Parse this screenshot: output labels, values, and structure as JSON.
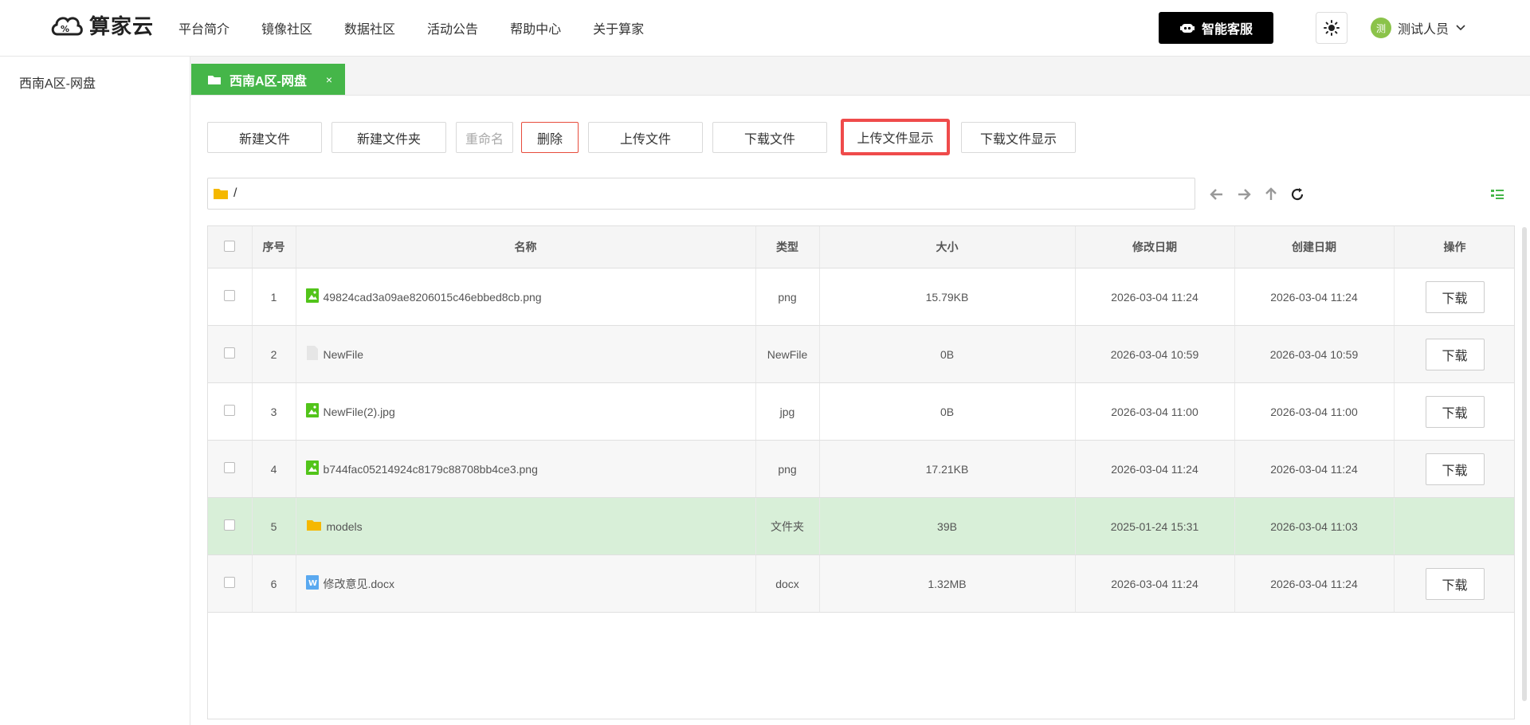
{
  "header": {
    "logo_text": "算家云",
    "nav": [
      "平台简介",
      "镜像社区",
      "数据社区",
      "活动公告",
      "帮助中心",
      "关于算家"
    ],
    "service_label": "智能客服",
    "user_avatar": "测",
    "user_name": "测试人员"
  },
  "sidebar": {
    "item": "西南A区-网盘"
  },
  "tab": {
    "label": "西南A区-网盘",
    "close": "×"
  },
  "toolbar": {
    "new_file": "新建文件",
    "new_folder": "新建文件夹",
    "rename": "重命名",
    "delete": "删除",
    "upload": "上传文件",
    "download": "下载文件",
    "upload_show": "上传文件显示",
    "download_show": "下载文件显示"
  },
  "path": {
    "value": "/"
  },
  "table": {
    "headers": {
      "index": "序号",
      "name": "名称",
      "type": "类型",
      "size": "大小",
      "modified": "修改日期",
      "created": "创建日期",
      "action": "操作"
    },
    "download_label": "下载",
    "rows": [
      {
        "index": "1",
        "icon": "image-file-icon",
        "name": "49824cad3a09ae8206015c46ebbed8cb.png",
        "type": "png",
        "size": "15.79KB",
        "modified": "2026-03-04 11:24",
        "created": "2026-03-04 11:24",
        "has_download": true
      },
      {
        "index": "2",
        "icon": "blank-file-icon",
        "name": "NewFile",
        "type": "NewFile",
        "size": "0B",
        "modified": "2026-03-04 10:59",
        "created": "2026-03-04 10:59",
        "has_download": true
      },
      {
        "index": "3",
        "icon": "image-file-icon",
        "name": "NewFile(2).jpg",
        "type": "jpg",
        "size": "0B",
        "modified": "2026-03-04 11:00",
        "created": "2026-03-04 11:00",
        "has_download": true
      },
      {
        "index": "4",
        "icon": "image-file-icon",
        "name": "b744fac05214924c8179c88708bb4ce3.png",
        "type": "png",
        "size": "17.21KB",
        "modified": "2026-03-04 11:24",
        "created": "2026-03-04 11:24",
        "has_download": true
      },
      {
        "index": "5",
        "icon": "folder-icon",
        "name": "models",
        "type": "文件夹",
        "size": "39B",
        "modified": "2025-01-24 15:31",
        "created": "2026-03-04 11:03",
        "has_download": false,
        "selected": true
      },
      {
        "index": "6",
        "icon": "word-file-icon",
        "name": "修改意见.docx",
        "type": "docx",
        "size": "1.32MB",
        "modified": "2026-03-04 11:24",
        "created": "2026-03-04 11:24",
        "has_download": true
      }
    ]
  },
  "colors": {
    "accent": "#45b649",
    "highlight": "#ef4b4b",
    "selected_row": "#d8efd8"
  }
}
